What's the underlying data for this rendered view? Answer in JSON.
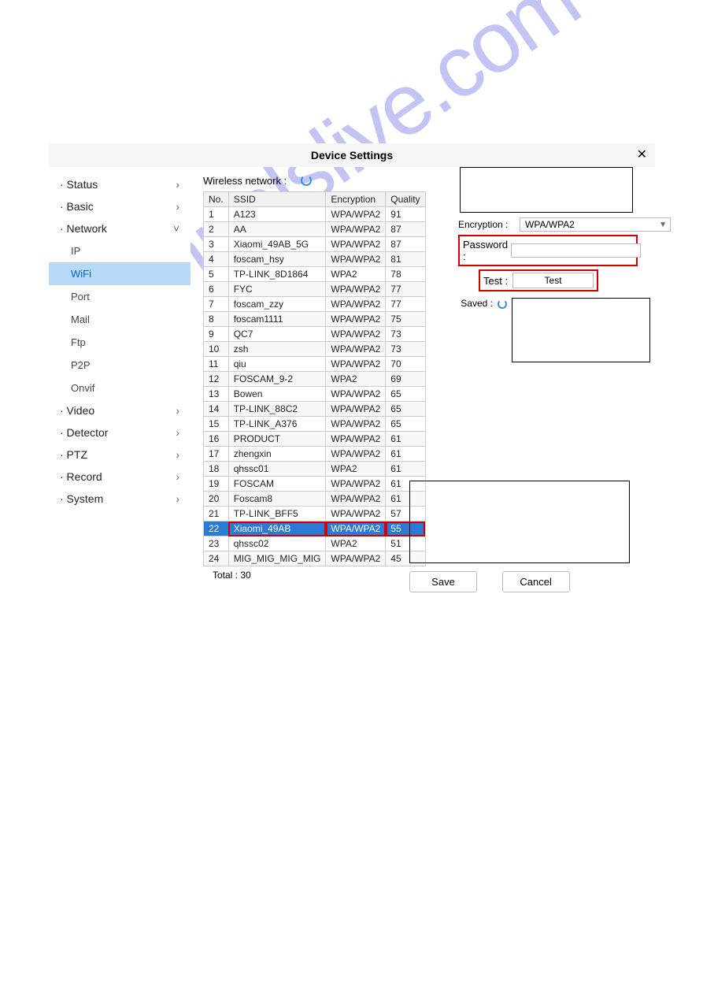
{
  "watermark": "manualslive.com",
  "titlebar": {
    "title": "Device Settings"
  },
  "sidebar": [
    {
      "label": "Status",
      "expandable": true,
      "expanded": false
    },
    {
      "label": "Basic",
      "expandable": true,
      "expanded": false
    },
    {
      "label": "Network",
      "expandable": true,
      "expanded": true,
      "children": [
        {
          "label": "IP"
        },
        {
          "label": "WiFi",
          "active": true
        },
        {
          "label": "Port"
        },
        {
          "label": "Mail"
        },
        {
          "label": "Ftp"
        },
        {
          "label": "P2P"
        },
        {
          "label": "Onvif"
        }
      ]
    },
    {
      "label": "Video",
      "expandable": true,
      "expanded": false
    },
    {
      "label": "Detector",
      "expandable": true,
      "expanded": false
    },
    {
      "label": "PTZ",
      "expandable": true,
      "expanded": false
    },
    {
      "label": "Record",
      "expandable": true,
      "expanded": false
    },
    {
      "label": "System",
      "expandable": true,
      "expanded": false
    }
  ],
  "wireless": {
    "label": "Wireless network :",
    "headers": {
      "no": "No.",
      "ssid": "SSID",
      "encryption": "Encryption",
      "quality": "Quality"
    },
    "rows": [
      {
        "no": 1,
        "ssid": "A123",
        "enc": "WPA/WPA2",
        "q": 91
      },
      {
        "no": 2,
        "ssid": "AA",
        "enc": "WPA/WPA2",
        "q": 87
      },
      {
        "no": 3,
        "ssid": "Xiaomi_49AB_5G",
        "enc": "WPA/WPA2",
        "q": 87
      },
      {
        "no": 4,
        "ssid": "foscam_hsy",
        "enc": "WPA/WPA2",
        "q": 81
      },
      {
        "no": 5,
        "ssid": "TP-LINK_8D1864",
        "enc": "WPA2",
        "q": 78
      },
      {
        "no": 6,
        "ssid": "FYC",
        "enc": "WPA/WPA2",
        "q": 77
      },
      {
        "no": 7,
        "ssid": "foscam_zzy",
        "enc": "WPA/WPA2",
        "q": 77
      },
      {
        "no": 8,
        "ssid": "foscam1111",
        "enc": "WPA/WPA2",
        "q": 75
      },
      {
        "no": 9,
        "ssid": "QC7",
        "enc": "WPA/WPA2",
        "q": 73
      },
      {
        "no": 10,
        "ssid": "zsh",
        "enc": "WPA/WPA2",
        "q": 73
      },
      {
        "no": 11,
        "ssid": "qiu",
        "enc": "WPA/WPA2",
        "q": 70
      },
      {
        "no": 12,
        "ssid": "FOSCAM_9-2",
        "enc": "WPA2",
        "q": 69
      },
      {
        "no": 13,
        "ssid": "Bowen",
        "enc": "WPA/WPA2",
        "q": 65
      },
      {
        "no": 14,
        "ssid": "TP-LINK_88C2",
        "enc": "WPA/WPA2",
        "q": 65
      },
      {
        "no": 15,
        "ssid": "TP-LINK_A376",
        "enc": "WPA/WPA2",
        "q": 65
      },
      {
        "no": 16,
        "ssid": "PRODUCT",
        "enc": "WPA/WPA2",
        "q": 61
      },
      {
        "no": 17,
        "ssid": "zhengxin",
        "enc": "WPA/WPA2",
        "q": 61
      },
      {
        "no": 18,
        "ssid": "qhssc01",
        "enc": "WPA2",
        "q": 61
      },
      {
        "no": 19,
        "ssid": "FOSCAM",
        "enc": "WPA/WPA2",
        "q": 61
      },
      {
        "no": 20,
        "ssid": "Foscam8",
        "enc": "WPA/WPA2",
        "q": 61
      },
      {
        "no": 21,
        "ssid": "TP-LINK_BFF5",
        "enc": "WPA/WPA2",
        "q": 57
      },
      {
        "no": 22,
        "ssid": "Xiaomi_49AB",
        "enc": "WPA/WPA2",
        "q": 55,
        "selected": true
      },
      {
        "no": 23,
        "ssid": "qhssc02",
        "enc": "WPA2",
        "q": 51
      },
      {
        "no": 24,
        "ssid": "MIG_MIG_MIG_MIG",
        "enc": "WPA/WPA2",
        "q": 45
      }
    ],
    "total_label": "Total : 30"
  },
  "form": {
    "encryption_label": "Encryption :",
    "encryption_value": "WPA/WPA2",
    "password_label": "Password :",
    "test_label": "Test :",
    "test_button": "Test",
    "saved_label": "Saved :"
  },
  "buttons": {
    "save": "Save",
    "cancel": "Cancel"
  }
}
